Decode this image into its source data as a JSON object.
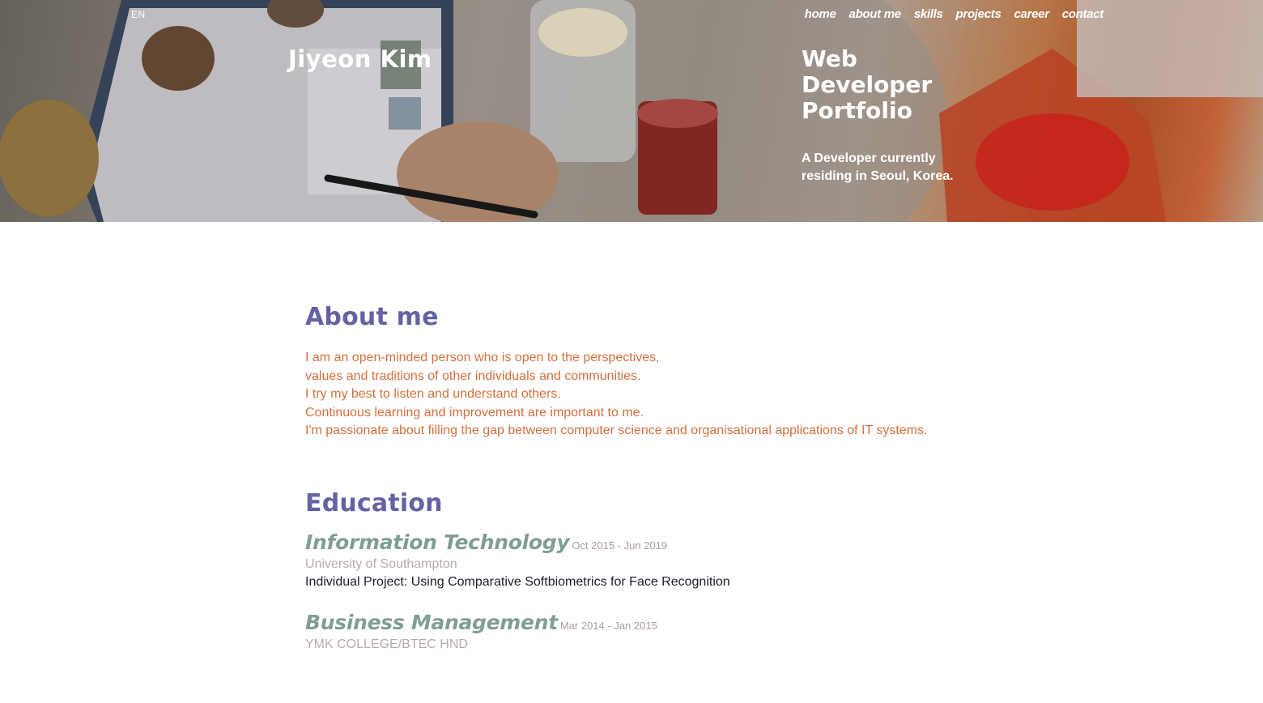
{
  "header": {
    "language": "EN",
    "nav": [
      "home",
      "about me",
      "skills",
      "projects",
      "career",
      "contact"
    ],
    "name": "Jiyeon Kim",
    "title_lines": [
      "Web",
      "Developer",
      "Portfolio"
    ],
    "subtitle_lines": [
      "A Developer currently",
      "residing in Seoul, Korea."
    ]
  },
  "about": {
    "heading": "About me",
    "lines": [
      "I am an open-minded person who is open to the perspectives,",
      "values and traditions of other individuals and communities.",
      "I try my best to listen and understand others.",
      "Continuous learning and improvement are important to me.",
      "I'm passionate about filling the gap between computer science and organisational applications of IT systems."
    ]
  },
  "education": {
    "heading": "Education",
    "items": [
      {
        "degree": "Information Technology",
        "dates": "Oct 2015 - Jun 2019",
        "school": "University of Southampton",
        "project": "Individual Project: Using Comparative Softbiometrics for Face Recognition"
      },
      {
        "degree": "Business Management",
        "dates": "Mar 2014 - Jan 2015",
        "school": "YMK COLLEGE/BTEC HND"
      }
    ]
  },
  "colors": {
    "heading": "#6462a2",
    "about_text": "#d46f3c",
    "degree": "#7f9e94",
    "school": "#b9a8b0"
  }
}
